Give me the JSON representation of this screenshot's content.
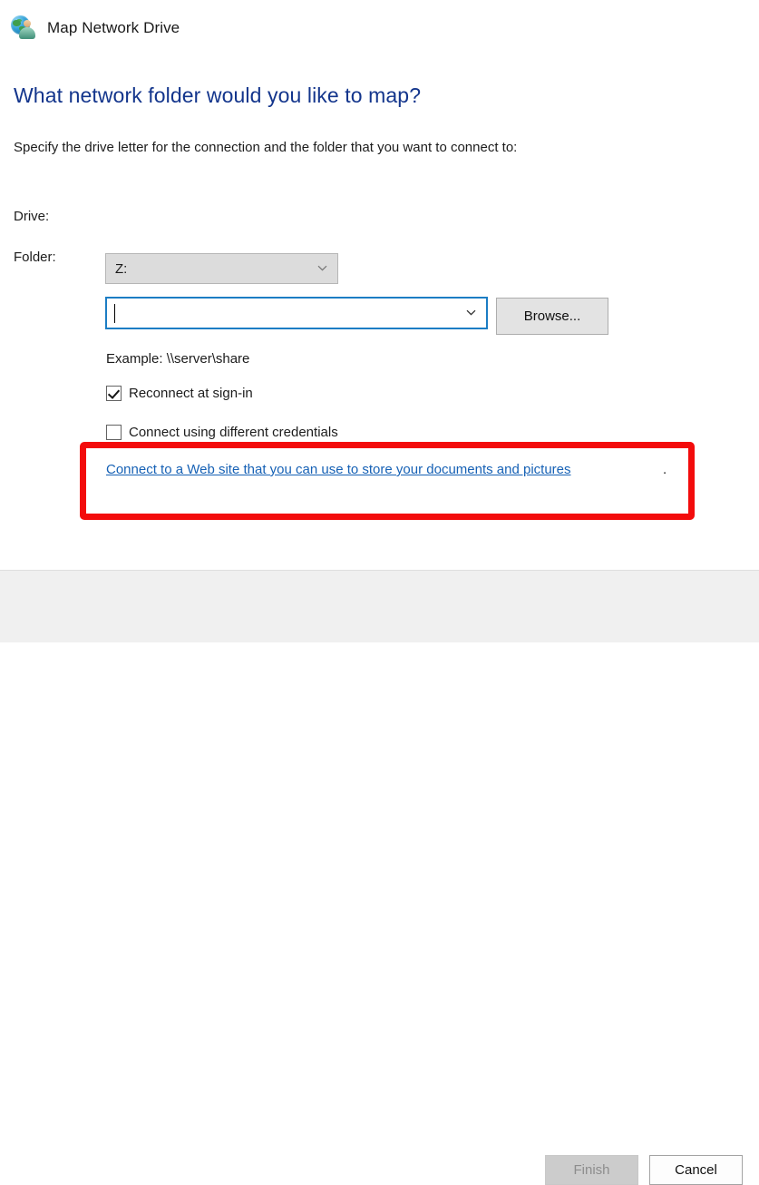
{
  "window": {
    "title": "Map Network Drive",
    "icon": "network-drive-globe-person-icon"
  },
  "main": {
    "heading": "What network folder would you like to map?",
    "subtitle": "Specify the drive letter for the connection and the folder that you want to connect to:",
    "fields": {
      "drive": {
        "label": "Drive:",
        "value": "Z:",
        "chevron_icon": "chevron-down-icon"
      },
      "folder": {
        "label": "Folder:",
        "value": "",
        "placeholder": "",
        "chevron_icon": "chevron-down-icon",
        "browse_label": "Browse..."
      }
    },
    "example_text": "Example: \\\\server\\share",
    "checkboxes": [
      {
        "label": "Reconnect at sign-in",
        "checked": true
      },
      {
        "label": "Connect using different credentials",
        "checked": false
      }
    ],
    "web_link": {
      "text": "Connect to a Web site that you can use to store your documents and pictures",
      "trailing_period": "."
    },
    "highlight": {
      "shape": "rectangle",
      "color": "#f30c0c"
    }
  },
  "footer": {
    "finish_label": "Finish",
    "finish_enabled": false,
    "cancel_label": "Cancel",
    "cancel_enabled": true
  },
  "colors": {
    "heading_blue": "#13358c",
    "link_blue": "#1661b5",
    "focus_border": "#1c7dc4",
    "annotation_red": "#f30c0c",
    "footer_bg": "#f0f0f0"
  }
}
